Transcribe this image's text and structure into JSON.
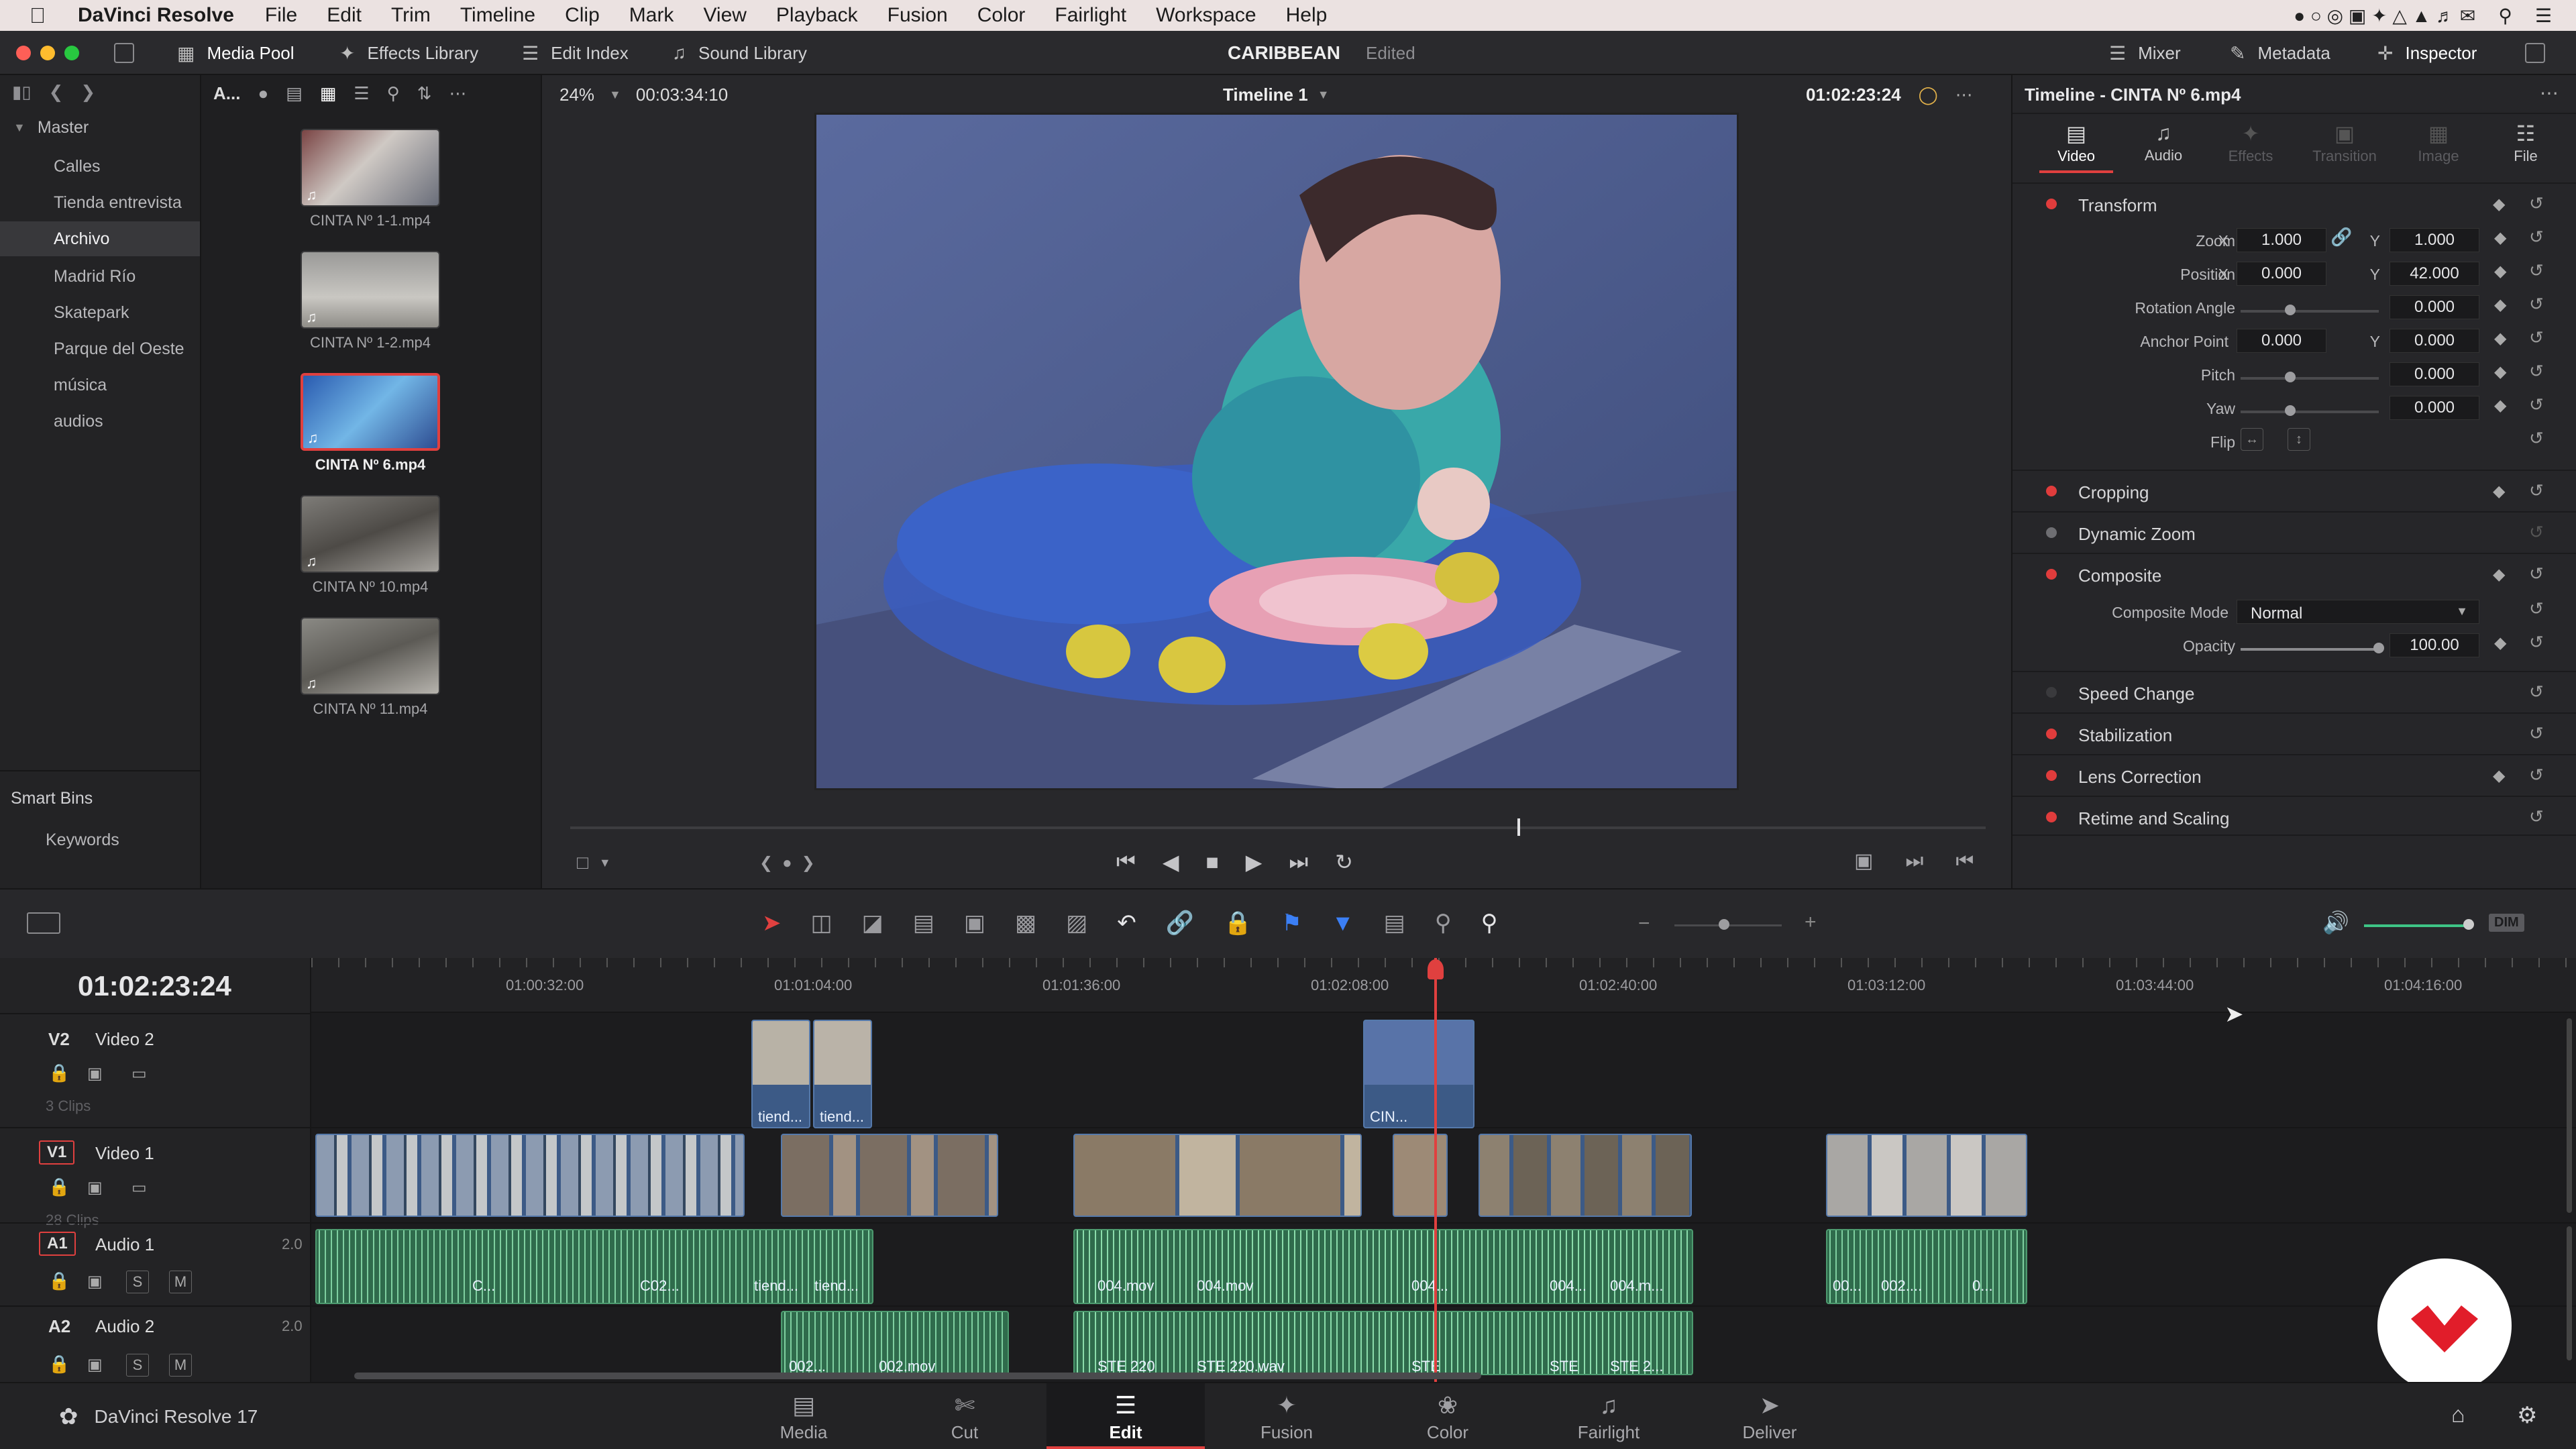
{
  "menubar": {
    "app": "DaVinci Resolve",
    "items": [
      "File",
      "Edit",
      "Trim",
      "Timeline",
      "Clip",
      "Mark",
      "View",
      "Playback",
      "Fusion",
      "Color",
      "Fairlight",
      "Workspace",
      "Help"
    ]
  },
  "toolbar": {
    "media_pool": "Media Pool",
    "effects_library": "Effects Library",
    "edit_index": "Edit Index",
    "sound_library": "Sound Library",
    "project": "CARIBBEAN",
    "project_status": "Edited",
    "mixer": "Mixer",
    "metadata": "Metadata",
    "inspector": "Inspector"
  },
  "media_pool": {
    "sort_label": "A...",
    "master": "Master",
    "bins": [
      "Calles",
      "Tienda entrevista",
      "Archivo",
      "Madrid Río",
      "Skatepark",
      "Parque del Oeste",
      "música",
      "audios"
    ],
    "selected_bin": "Archivo",
    "smart_bins": "Smart Bins",
    "keywords": "Keywords",
    "clips": [
      "CINTA Nº 1-1.mp4",
      "CINTA Nº 1-2.mp4",
      "CINTA Nº 6.mp4",
      "CINTA Nº 10.mp4",
      "CINTA Nº 11.mp4"
    ],
    "selected_clip": "CINTA Nº 6.mp4"
  },
  "viewer": {
    "zoom": "24%",
    "duration": "00:03:34:10",
    "timeline_name": "Timeline 1",
    "timecode": "01:02:23:24"
  },
  "inspector": {
    "title": "Timeline - CINTA Nº 6.mp4",
    "tabs": [
      "Video",
      "Audio",
      "Effects",
      "Transition",
      "Image",
      "File"
    ],
    "active_tab": "Video",
    "transform": "Transform",
    "zoom_label": "Zoom",
    "zoom_x": "1.000",
    "zoom_y": "1.000",
    "position_label": "Position",
    "position_x": "0.000",
    "position_y": "42.000",
    "rotation_label": "Rotation Angle",
    "rotation": "0.000",
    "anchor_label": "Anchor Point",
    "anchor_x": "0.000",
    "anchor_y": "0.000",
    "pitch_label": "Pitch",
    "pitch": "0.000",
    "yaw_label": "Yaw",
    "yaw": "0.000",
    "flip_label": "Flip",
    "x": "X",
    "y": "Y",
    "cropping": "Cropping",
    "dynamic_zoom": "Dynamic Zoom",
    "composite": "Composite",
    "composite_mode_label": "Composite Mode",
    "composite_mode": "Normal",
    "opacity_label": "Opacity",
    "opacity": "100.00",
    "speed_change": "Speed Change",
    "stabilization": "Stabilization",
    "lens_correction": "Lens Correction",
    "retime_scaling": "Retime and Scaling"
  },
  "timeline": {
    "timecode": "01:02:23:24",
    "ruler": [
      "01:00:32:00",
      "01:01:04:00",
      "01:01:36:00",
      "01:02:08:00",
      "01:02:40:00",
      "01:03:12:00",
      "01:03:44:00",
      "01:04:16:00"
    ],
    "tracks": {
      "v2": {
        "id": "V2",
        "name": "Video 2",
        "clips": "3 Clips"
      },
      "v1": {
        "id": "V1",
        "name": "Video 1",
        "clips": "28 Clips"
      },
      "a1": {
        "id": "A1",
        "name": "Audio 1",
        "level": "2.0"
      },
      "a2": {
        "id": "A2",
        "name": "Audio 2",
        "level": "2.0"
      }
    },
    "v2_labels": [
      "tiend...",
      "tiend...",
      "CIN..."
    ],
    "a1_labels": [
      "C...",
      "C02...",
      "tiend...",
      "tiend...",
      "004.mov",
      "004.mov",
      "004...",
      "004...",
      "004.m...",
      "00...",
      "002....",
      "0..."
    ],
    "a2_labels": [
      "002...",
      "002.mov",
      "STE 220",
      "STE 220.wav",
      "STE",
      "STE",
      "STE 2..."
    ],
    "solo": "S",
    "mute": "M",
    "dim": "DIM"
  },
  "pages": [
    "Media",
    "Cut",
    "Edit",
    "Fusion",
    "Color",
    "Fairlight",
    "Deliver"
  ],
  "active_page": "Edit",
  "version": "DaVinci Resolve 17"
}
